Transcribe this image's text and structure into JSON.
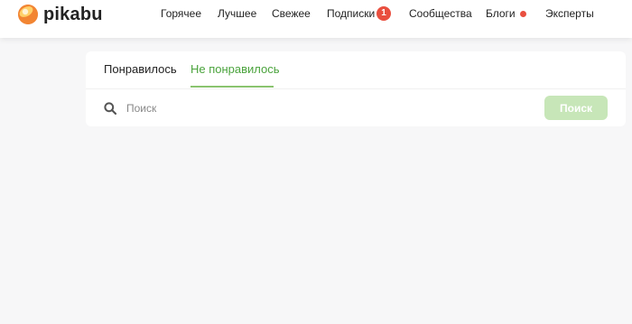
{
  "header": {
    "logo_text": "pikabu",
    "nav": [
      {
        "label": "Горячее"
      },
      {
        "label": "Лучшее"
      },
      {
        "label": "Свежее"
      },
      {
        "label": "Подписки",
        "badge": "1"
      },
      {
        "label": "Сообщества"
      },
      {
        "label": "Блоги",
        "dot": true
      },
      {
        "label": "Эксперты"
      }
    ]
  },
  "tabs": [
    {
      "label": "Понравилось",
      "active": false
    },
    {
      "label": "Не понравилось",
      "active": true
    }
  ],
  "search": {
    "placeholder": "Поиск",
    "button_label": "Поиск"
  },
  "colors": {
    "accent_green": "#4aa33c",
    "button_green": "#c7e6b8",
    "badge_red": "#e94f3f",
    "background": "#f7f7f8"
  }
}
